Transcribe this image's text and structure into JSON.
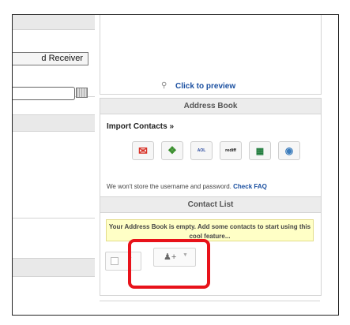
{
  "left": {
    "receiver_button": "d Receiver"
  },
  "preview": {
    "link_text": "Click to preview",
    "icon": "magnifier-icon"
  },
  "address_book": {
    "header": "Address Book",
    "import_title": "Import Contacts »",
    "providers": [
      {
        "name": "Gmail",
        "icon": "gmail-icon"
      },
      {
        "name": "Windows Live",
        "icon": "windows-icon"
      },
      {
        "name": "AOL",
        "icon": "aol-icon"
      },
      {
        "name": "rediff",
        "icon": "rediff-icon"
      },
      {
        "name": "Excel",
        "icon": "excel-icon"
      },
      {
        "name": "Outlook",
        "icon": "outlook-icon"
      }
    ],
    "disclaimer": "We won't store the username and password.",
    "check_faq": "Check FAQ",
    "provider_labels": {
      "aol": "AOL",
      "rediff": "rediff"
    }
  },
  "contact_list": {
    "header": "Contact List",
    "empty_message": "Your Address Book is empty. Add some contacts to start using this cool feature...",
    "select_icon": "checkbox-icon",
    "add_icon": "add-person-icon"
  },
  "colors": {
    "link": "#1a4fa0",
    "highlight": "#e8121a",
    "note_bg": "#ffffc6"
  }
}
